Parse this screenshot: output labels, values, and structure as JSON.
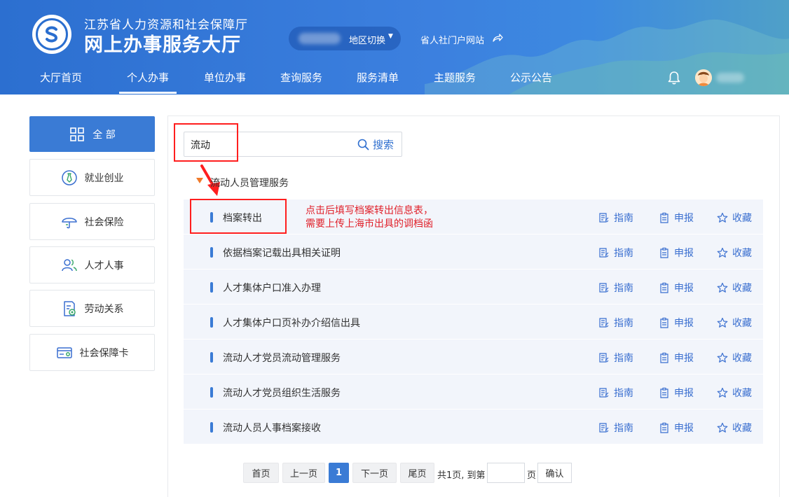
{
  "header": {
    "org_name": "江苏省人力资源和社会保障厅",
    "site_title": "网上办事服务大厅",
    "region_switch": "地区切换",
    "portal_link": "省人社门户网站"
  },
  "nav": {
    "items": [
      "大厅首页",
      "个人办事",
      "单位办事",
      "查询服务",
      "服务清单",
      "主题服务",
      "公示公告"
    ],
    "active": "个人办事"
  },
  "sidebar": {
    "items": [
      {
        "label": "全 部",
        "icon": "grid-icon",
        "active": true
      },
      {
        "label": "就业创业",
        "icon": "tie-icon"
      },
      {
        "label": "社会保险",
        "icon": "umbrella-icon"
      },
      {
        "label": "人才人事",
        "icon": "people-icon"
      },
      {
        "label": "劳动关系",
        "icon": "document-icon"
      },
      {
        "label": "社会保障卡",
        "icon": "card-icon"
      }
    ]
  },
  "search": {
    "value": "流动",
    "button_label": "搜索"
  },
  "category": {
    "title": "流动人员管理服务"
  },
  "actions": {
    "guide": "指南",
    "apply": "申报",
    "favorite": "收藏"
  },
  "services": [
    "档案转出",
    "依据档案记载出具相关证明",
    "人才集体户口准入办理",
    "人才集体户口页补办介绍信出具",
    "流动人才党员流动管理服务",
    "流动人才党员组织生活服务",
    "流动人员人事档案接收"
  ],
  "annotation": {
    "line1": "点击后填写档案转出信息表，",
    "line2": "需要上传上海市出具的调档函",
    "color": "#e0202a"
  },
  "pagination": {
    "first": "首页",
    "prev": "上一页",
    "current": "1",
    "next": "下一页",
    "last": "尾页",
    "summary": "共1页, 到第",
    "page_suffix": "页",
    "confirm": "确认"
  },
  "colors": {
    "primary": "#3a7bd5",
    "highlight_box": "#ff1e1e"
  }
}
